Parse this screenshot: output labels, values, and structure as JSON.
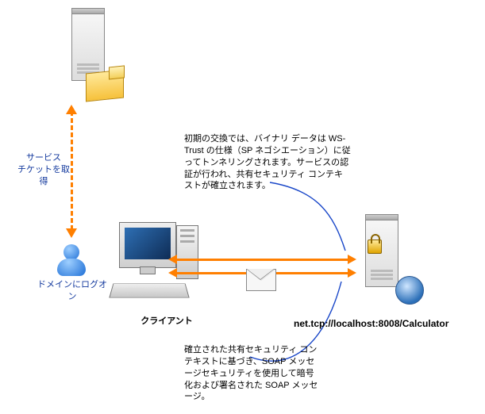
{
  "labels": {
    "get_ticket": "サービス\nチケットを取得",
    "domain_logon": "ドメインにログオン",
    "client": "クライアント",
    "service_url": "net.tcp://localhost:8008/Calculator"
  },
  "descriptions": {
    "initial_exchange": "初期の交換では、バイナリ データは WS-Trust の仕様（SP ネゴシエーション）に従ってトンネリングされます。サービスの認証が行われ、共有セキュリティ コンテキストが確立されます。",
    "soap_message": "確立された共有セキュリティ コンテキストに基づき、SOAP メッセージセキュリティを使用して暗号化および署名された SOAP メッセージ。"
  },
  "icons": {
    "kdc_server": "kdc-server",
    "ticket": "kerberos-ticket",
    "user": "user",
    "client_pc": "client-computer",
    "envelope": "soap-envelope",
    "service_server": "service-server",
    "lock": "lock",
    "token": "security-token"
  }
}
